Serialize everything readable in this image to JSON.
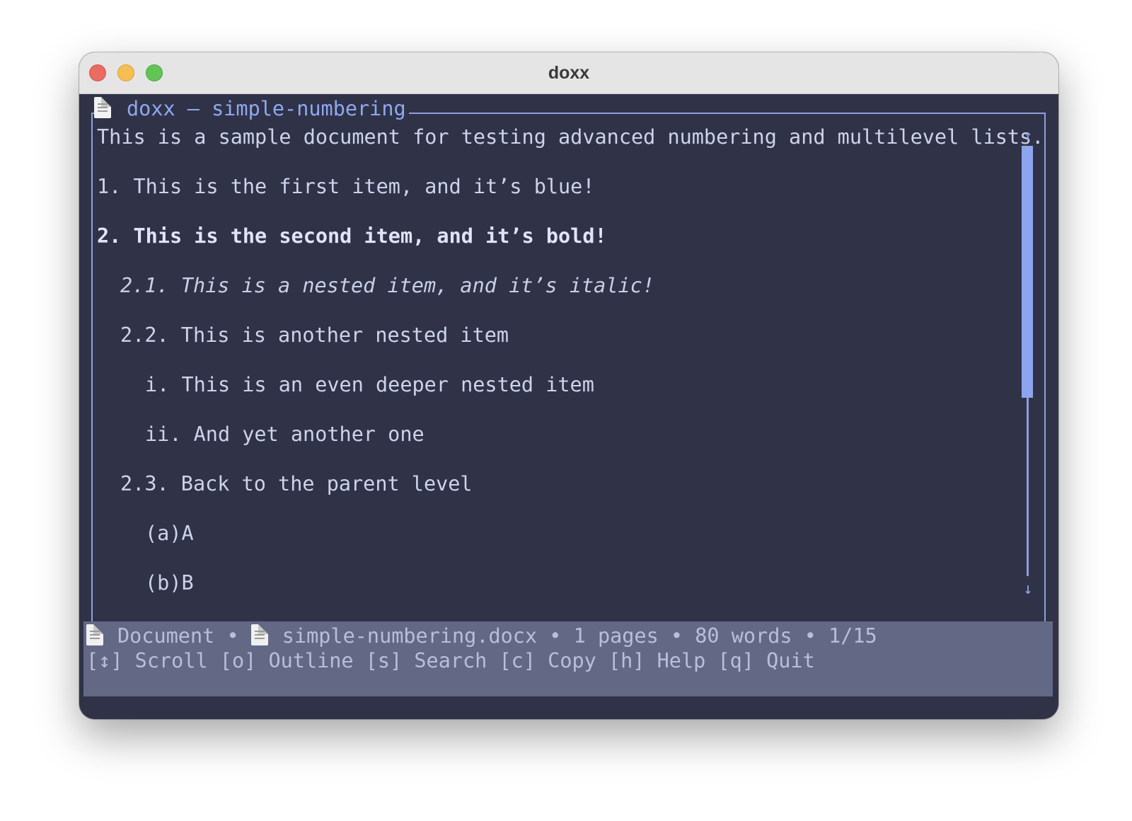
{
  "window": {
    "title": "doxx"
  },
  "frame": {
    "title": "doxx – simple-numbering"
  },
  "document": {
    "lines": [
      "This is a sample document for testing advanced numbering and multilevel lists.",
      "1. This is the first item, and it’s blue!",
      "2. This is the second item, and it’s bold!",
      "2.1. This is a nested item, and it’s italic!",
      "2.2. This is another nested item",
      "i. This is an even deeper nested item",
      "ii. And yet another one",
      "2.3. Back to the parent level",
      "(a)A",
      "(b)B"
    ]
  },
  "scrollbar": {
    "up_arrow": "↑",
    "down_arrow": "↓"
  },
  "status": {
    "mode": "Document",
    "filename": "simple-numbering.docx",
    "pages": "1 pages",
    "words": "80 words",
    "position": "1/15",
    "separator": "•",
    "shortcuts": [
      {
        "key": "[↕]",
        "label": "Scroll"
      },
      {
        "key": "[o]",
        "label": "Outline"
      },
      {
        "key": "[s]",
        "label": "Search"
      },
      {
        "key": "[c]",
        "label": "Copy"
      },
      {
        "key": "[h]",
        "label": "Help"
      },
      {
        "key": "[q]",
        "label": "Quit"
      }
    ]
  },
  "colors": {
    "terminal_bg": "#303347",
    "border": "#8e9fdb",
    "accent": "#8fa9f0",
    "text": "#cdd3ea",
    "statusbar_bg": "#636985"
  },
  "icons": {
    "document": "document-icon"
  }
}
